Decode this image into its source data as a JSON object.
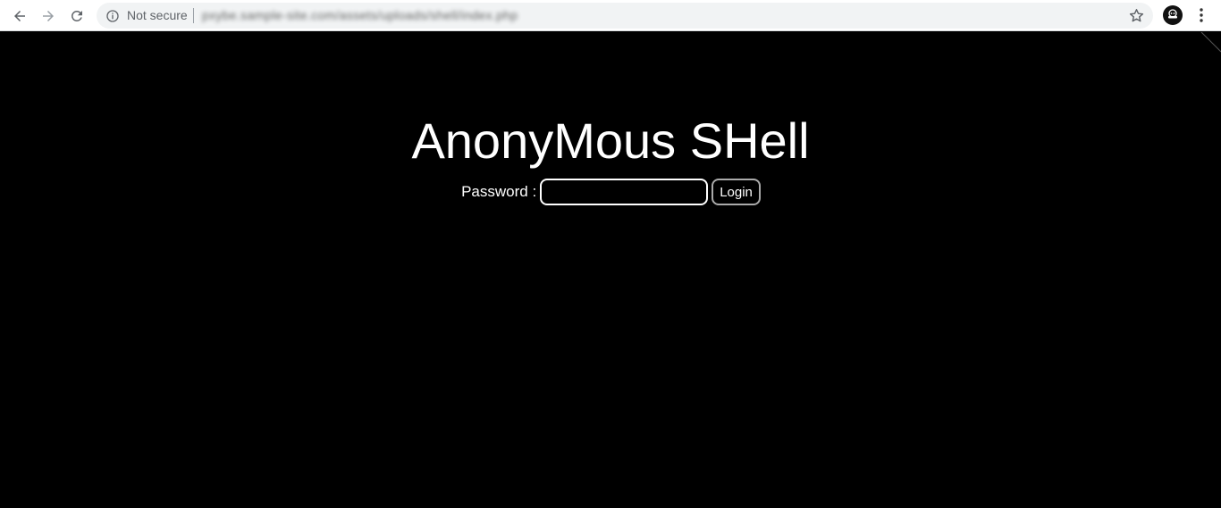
{
  "browser": {
    "security_label": "Not secure",
    "url": "pxybe.sample-site.com/assets/uploads/shell/index.php",
    "icons": {
      "back": "arrow-left-icon",
      "forward": "arrow-right-icon",
      "reload": "reload-icon",
      "info": "info-icon",
      "bookmark": "star-icon",
      "menu": "kebab-menu-icon",
      "profile": "avatar-icon"
    }
  },
  "page": {
    "title": "AnonyMous SHell",
    "password_label": "Password :",
    "password_value": "",
    "login_label": "Login",
    "background_color": "#000000",
    "text_color": "#ffffff"
  }
}
